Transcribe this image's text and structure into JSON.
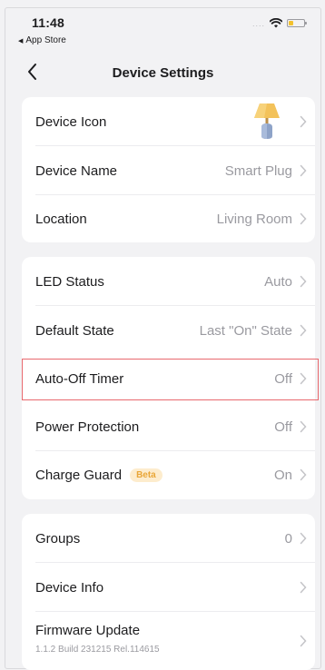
{
  "status_bar": {
    "time": "11:48",
    "back_app": "App Store",
    "back_icon": "triangle-left-icon",
    "battery_color": "#f2c12e",
    "battery_level": 0.3
  },
  "nav": {
    "title": "Device Settings",
    "back_icon": "chevron-left-icon"
  },
  "group1": {
    "device_icon_label": "Device Icon",
    "device_icon_image": "lamp-icon",
    "device_name_label": "Device Name",
    "device_name_value": "Smart Plug",
    "location_label": "Location",
    "location_value": "Living Room"
  },
  "group2": {
    "led_status_label": "LED Status",
    "led_status_value": "Auto",
    "default_state_label": "Default State",
    "default_state_value": "Last \"On\" State",
    "auto_off_label": "Auto-Off Timer",
    "auto_off_value": "Off",
    "power_protection_label": "Power Protection",
    "power_protection_value": "Off",
    "charge_guard_label": "Charge Guard",
    "charge_guard_badge": "Beta",
    "charge_guard_value": "On"
  },
  "group3": {
    "groups_label": "Groups",
    "groups_value": "0",
    "device_info_label": "Device Info",
    "firmware_label": "Firmware Update",
    "firmware_version": "1.1.2 Build 231215 Rel.114615"
  },
  "colors": {
    "background": "#f2f2f4",
    "card": "#ffffff",
    "highlight": "#e8696e",
    "beta_text": "#e9a638",
    "beta_bg": "#fdeccd"
  }
}
